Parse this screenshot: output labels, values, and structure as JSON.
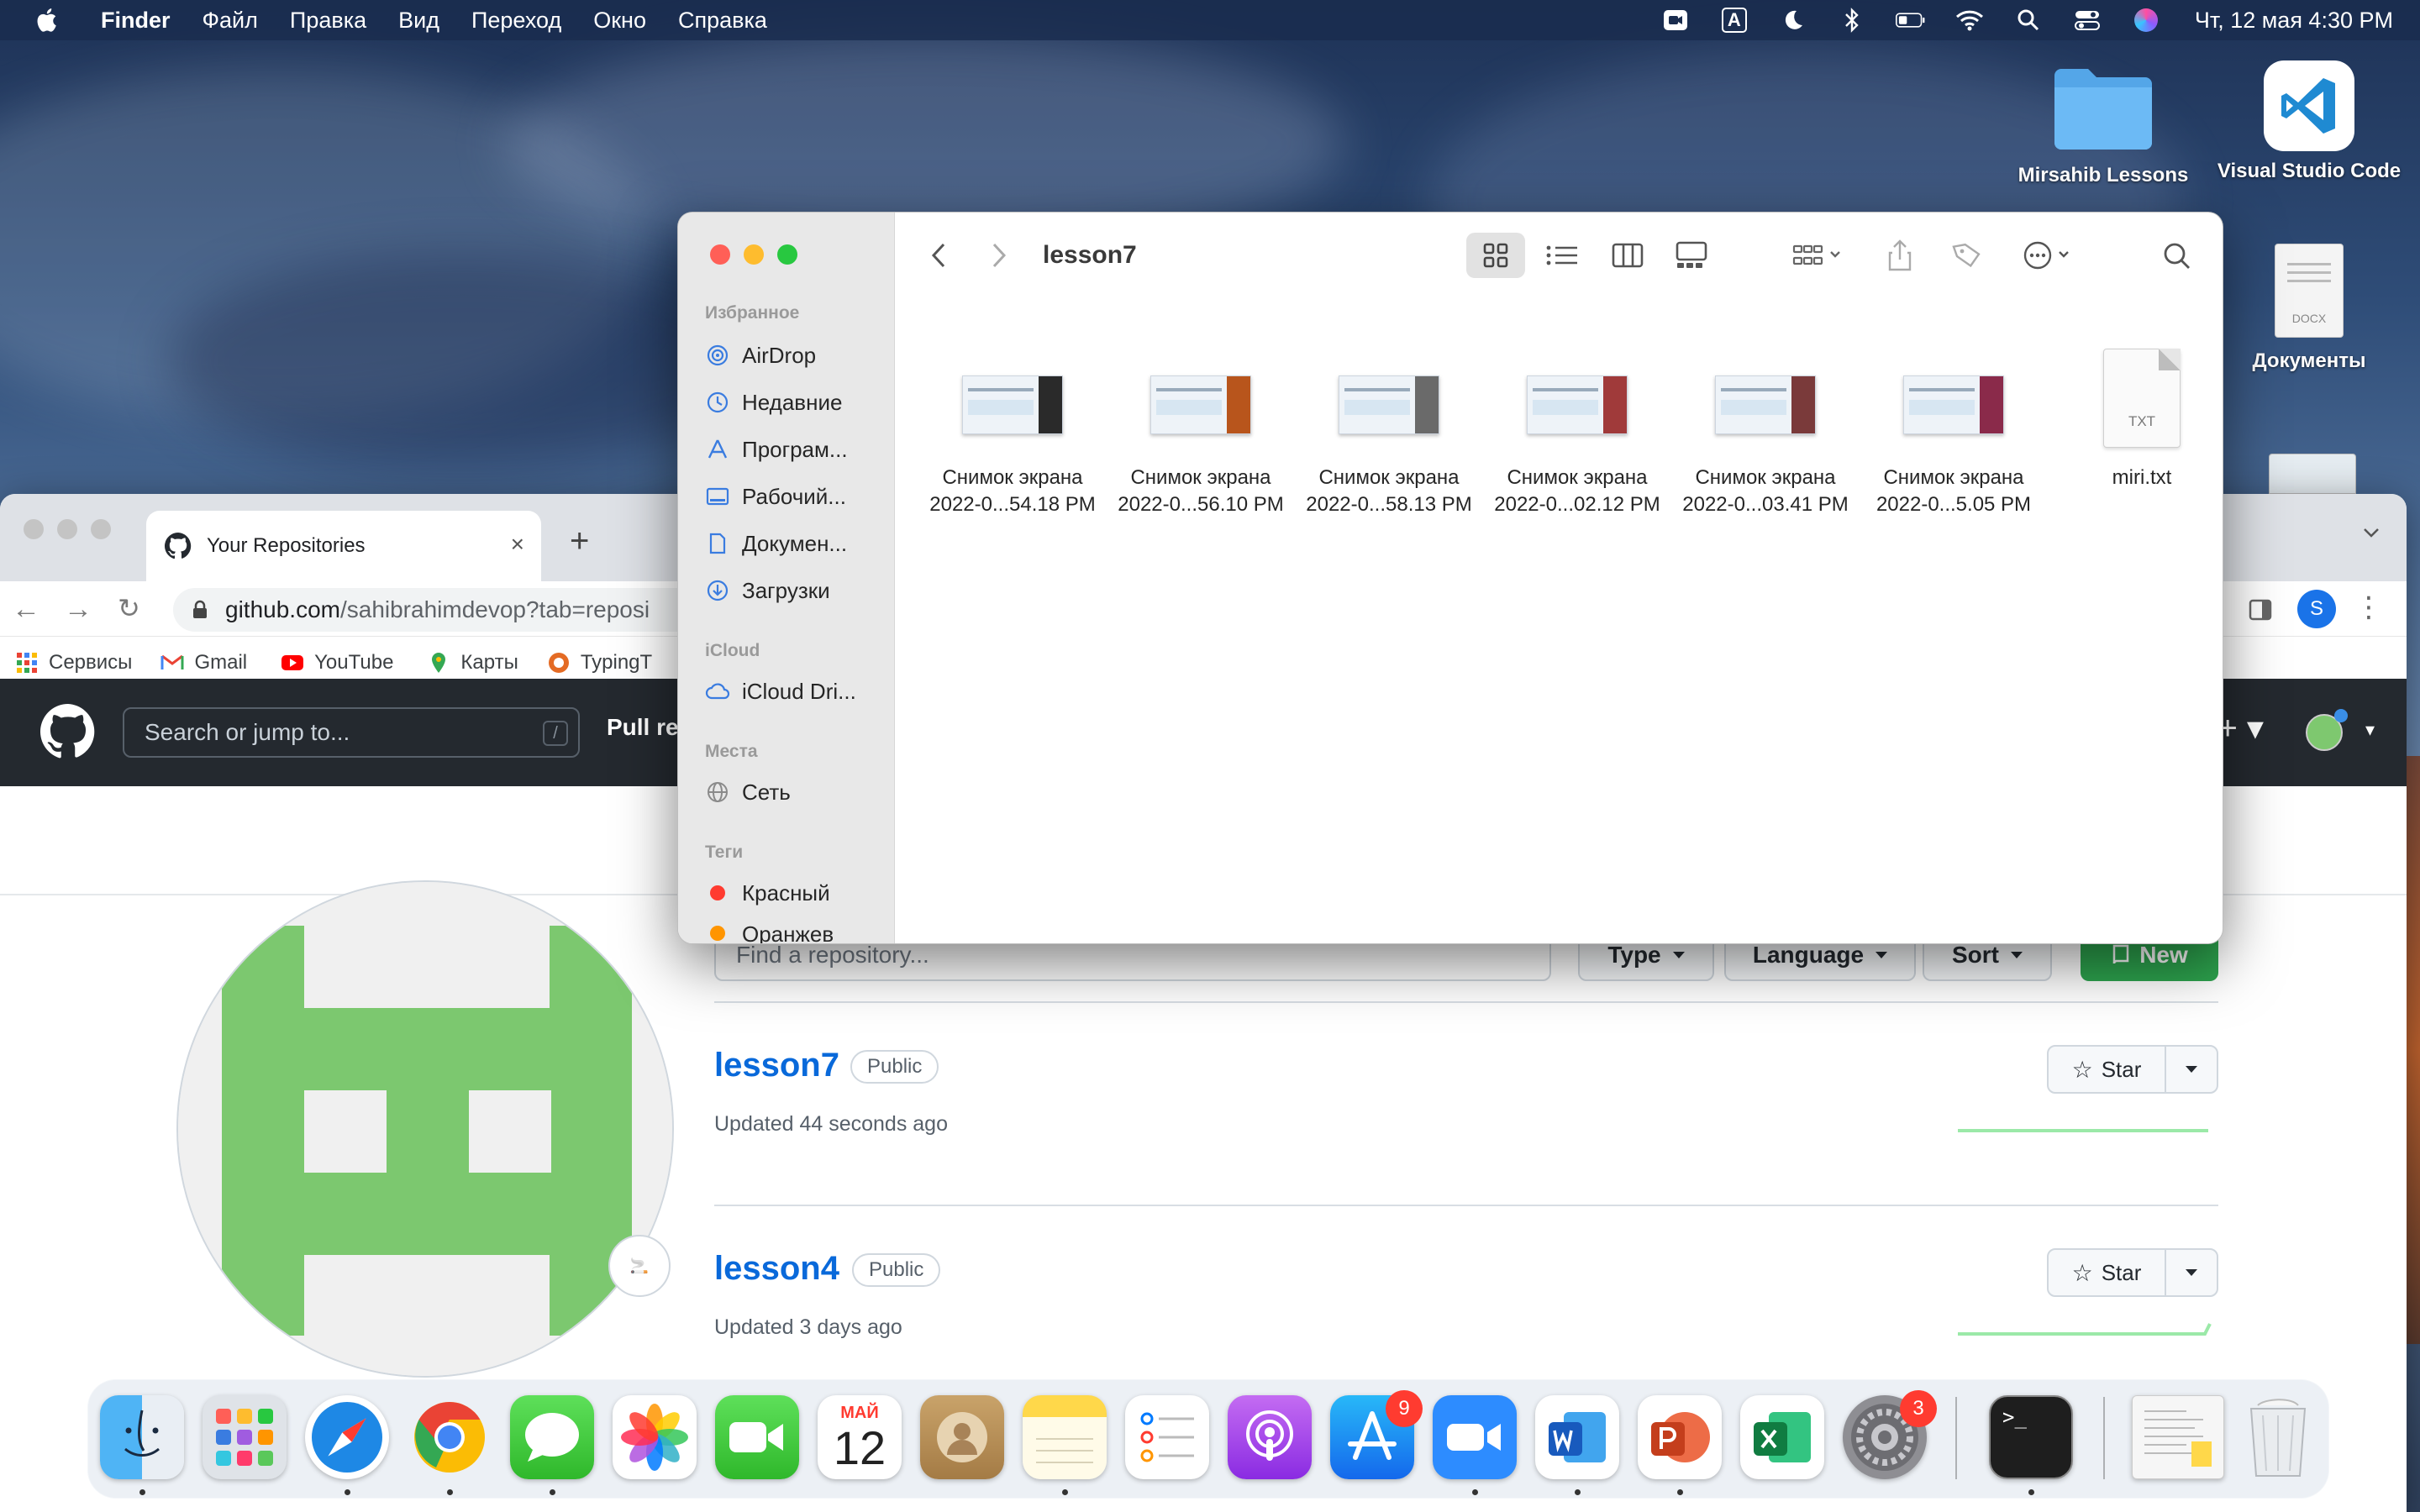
{
  "menubar": {
    "app": "Finder",
    "items": [
      "Файл",
      "Правка",
      "Вид",
      "Переход",
      "Окно",
      "Справка"
    ],
    "clock": "Чт, 12 мая  4:30 PM",
    "input_source": "A"
  },
  "desktop": {
    "icons": [
      {
        "label": "Mirsahib Lessons",
        "icon": "folder-icon"
      },
      {
        "label": "Visual Studio Code",
        "icon": "vscode-icon"
      },
      {
        "label": "Документы",
        "icon": "docx-file-icon"
      }
    ],
    "docx_label": "DOCX"
  },
  "browser": {
    "tab_title": "Your Repositories",
    "url_host": "github.com",
    "url_path": "/sahibrahimdevop?tab=reposi",
    "profile_initial": "S",
    "bookmarks": [
      "Сервисы",
      "Gmail",
      "YouTube",
      "Карты",
      "TypingT"
    ]
  },
  "github": {
    "search_placeholder": "Search or jump to...",
    "search_key": "/",
    "nav_pull": "Pull re",
    "find_placeholder": "Find a repository...",
    "type_label": "Type",
    "language_label": "Language",
    "sort_label": "Sort",
    "new_label": "New",
    "repos": [
      {
        "name": "lesson7",
        "visibility": "Public",
        "updated": "Updated 44 seconds ago",
        "star": "Star"
      },
      {
        "name": "lesson4",
        "visibility": "Public",
        "updated": "Updated 3 days ago",
        "star": "Star"
      }
    ]
  },
  "finder": {
    "title": "lesson7",
    "sections": {
      "favorites": "Избранное",
      "icloud": "iCloud",
      "places": "Места",
      "tags": "Теги"
    },
    "favorites": [
      "AirDrop",
      "Недавние",
      "Програм...",
      "Рабочий...",
      "Докумен...",
      "Загрузки"
    ],
    "icloud_items": [
      "iCloud Dri..."
    ],
    "places_items": [
      "Сеть"
    ],
    "tags_items": [
      {
        "label": "Красный",
        "color": "#ff3b30"
      },
      {
        "label": "Оранжев",
        "color": "#ff9500"
      }
    ],
    "files": [
      {
        "line1": "Снимок экрана",
        "line2": "2022-0...54.18 PM",
        "accent": "#2a2a2a"
      },
      {
        "line1": "Снимок экрана",
        "line2": "2022-0...56.10 PM",
        "accent": "#b8551c"
      },
      {
        "line1": "Снимок экрана",
        "line2": "2022-0...58.13 PM",
        "accent": "#6a6a6a"
      },
      {
        "line1": "Снимок экрана",
        "line2": "2022-0...02.12 PM",
        "accent": "#a03a3a"
      },
      {
        "line1": "Снимок экрана",
        "line2": "2022-0...03.41 PM",
        "accent": "#7a3a3a"
      },
      {
        "line1": "Снимок экрана",
        "line2": "2022-0...5.05 PM",
        "accent": "#8a2a4a"
      },
      {
        "line1": "miri.txt",
        "line2": "",
        "accent": ""
      }
    ],
    "txt_badge": "TXT"
  },
  "dock": {
    "apps": [
      "Finder",
      "Launchpad",
      "Safari",
      "Chrome",
      "Messages",
      "Photos",
      "FaceTime",
      "Calendar",
      "Contacts",
      "Notes",
      "Reminders",
      "Podcasts",
      "App Store",
      "Zoom",
      "Word",
      "PowerPoint",
      "Excel",
      "System Preferences",
      "Terminal",
      "Preview",
      "Trash"
    ],
    "calendar_month": "МАЙ",
    "calendar_day": "12",
    "appstore_badge": "9",
    "settings_badge": "3"
  },
  "colors": {
    "github_green": "#2da44e",
    "github_link": "#0969da",
    "github_header": "#24292f",
    "finder_sidebar": "#e8e8e8"
  }
}
